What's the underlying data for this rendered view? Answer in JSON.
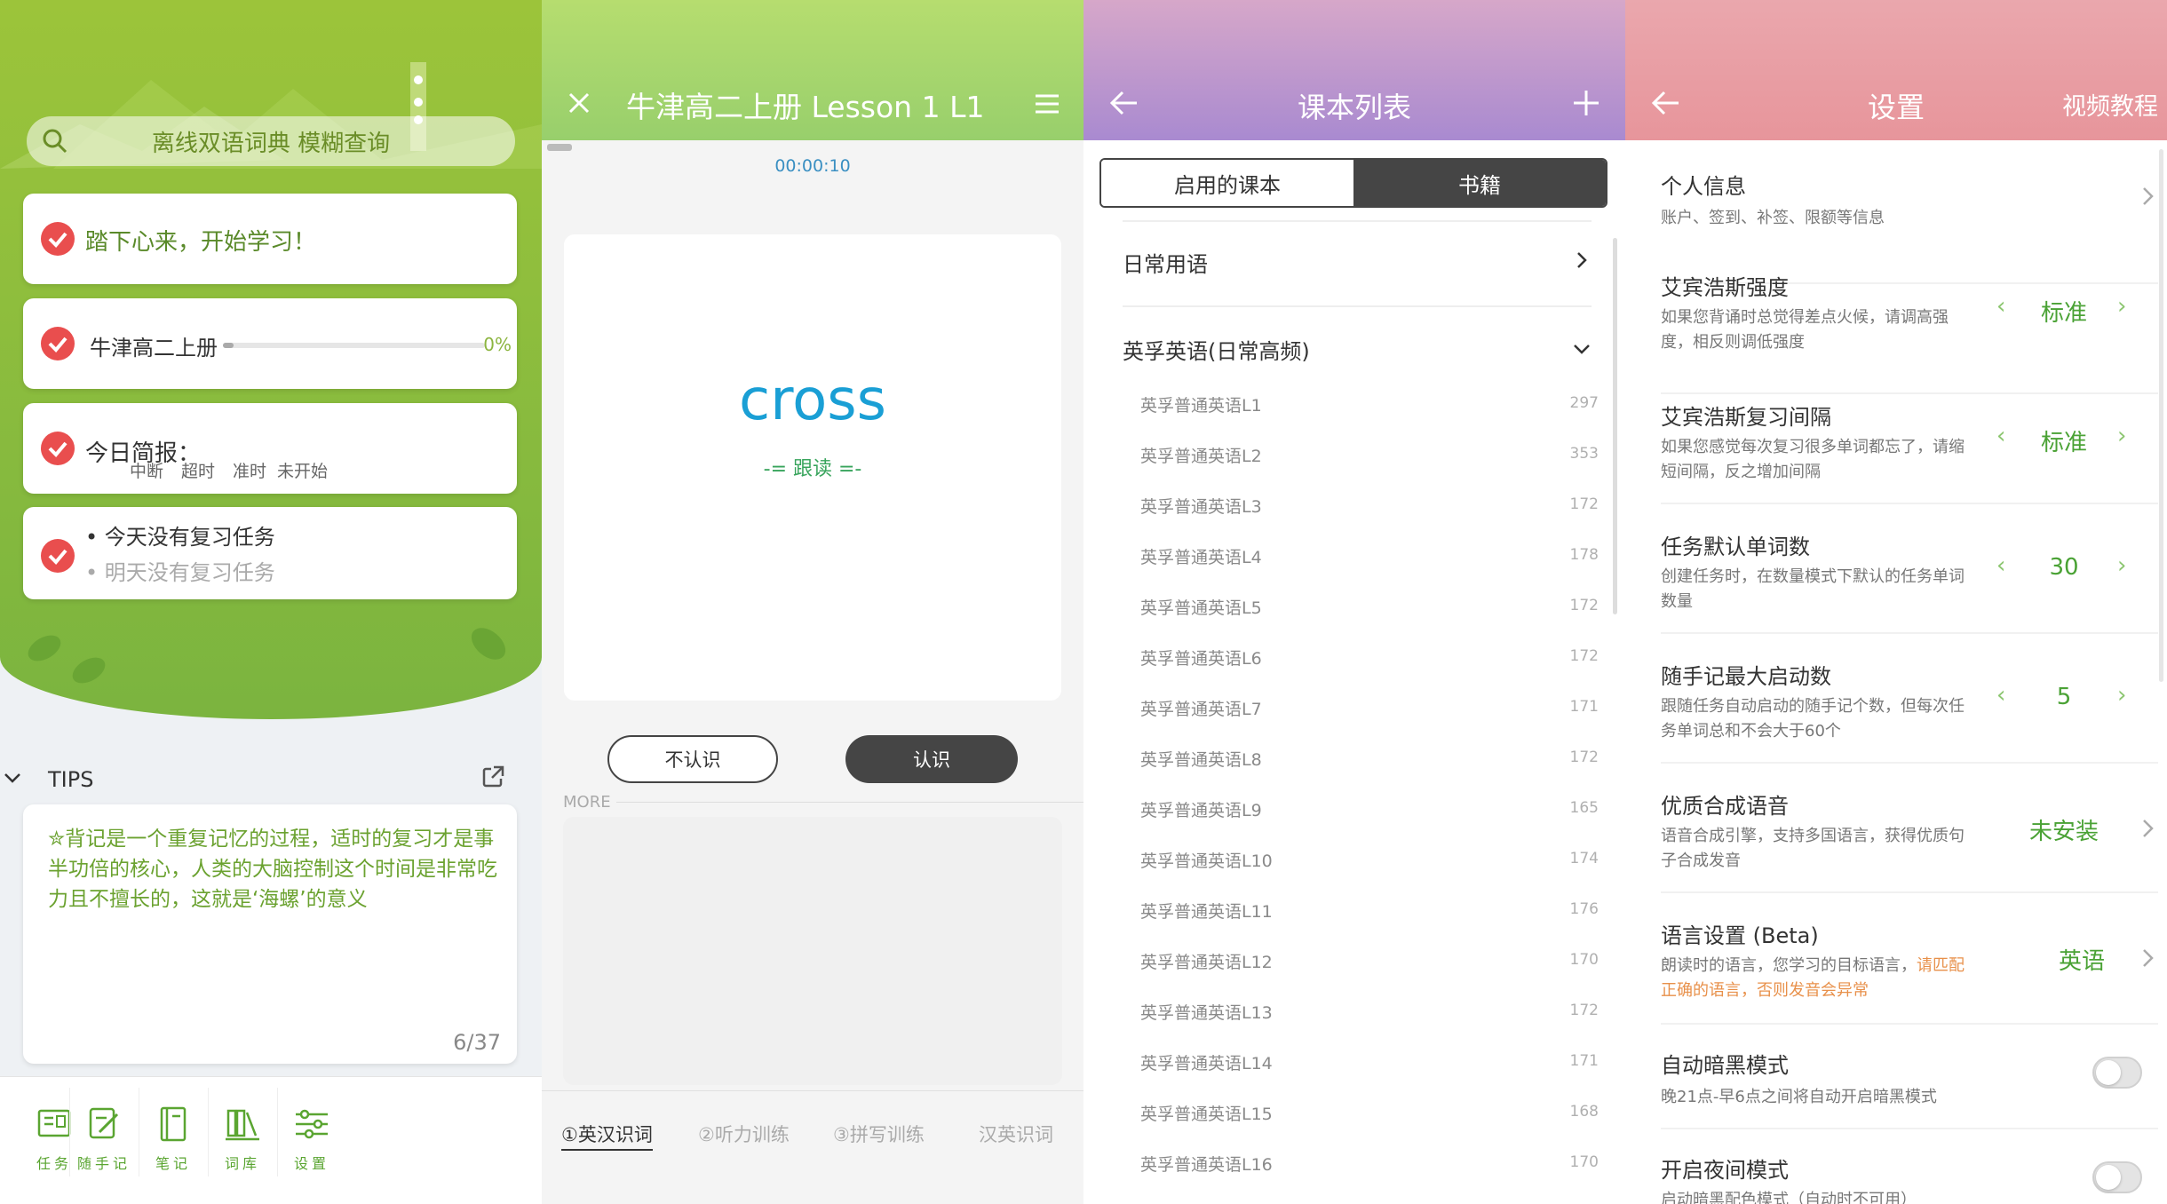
{
  "panel1": {
    "search_placeholder": "离线双语词典 模糊查询",
    "card_motivation": "踏下心来，开始学习！",
    "card_book_title": "牛津高二上册",
    "card_book_progress_label": "0%",
    "card_book_progress": 0.04,
    "card_brief_title": "今日简报：",
    "brief_labels": [
      "中断",
      "超时",
      "准时",
      "未开始"
    ],
    "review_today": "今天没有复习任务",
    "review_tomorrow": "明天没有复习任务",
    "tips_title": "TIPS",
    "tips_body": "✮背记是一个重复记忆的过程，适时的复习才是事半功倍的核心，人类的大脑控制这个时间是非常吃力且不擅长的，这就是‘海螺’的意义",
    "tips_page": "6/37",
    "tabs": [
      {
        "label": "任务",
        "icon": "task-icon"
      },
      {
        "label": "随手记",
        "icon": "note-pencil-icon"
      },
      {
        "label": "笔记",
        "icon": "notebook-icon"
      },
      {
        "label": "词库",
        "icon": "library-icon"
      },
      {
        "label": "设置",
        "icon": "settings-sliders-icon"
      }
    ],
    "accent": "#8fbe3d"
  },
  "panel2": {
    "title": "牛津高二上册 Lesson 1 L1",
    "timer": "00:00:10",
    "word": "cross",
    "follow": "-= 跟读 =-",
    "btn_unknown": "不认识",
    "btn_known": "认识",
    "more_label": "MORE",
    "tabs": [
      "①英汉识词",
      "②听力训练",
      "③拼写训练",
      "汉英识词"
    ],
    "accent": "#1a9fd5"
  },
  "panel3": {
    "title": "课本列表",
    "seg_enabled": "启用的课本",
    "seg_books": "书籍",
    "section1": "日常用语",
    "section2": "英孚英语(日常高频)",
    "lessons": [
      {
        "name": "英孚普通英语L1",
        "count": "297"
      },
      {
        "name": "英孚普通英语L2",
        "count": "353"
      },
      {
        "name": "英孚普通英语L3",
        "count": "172"
      },
      {
        "name": "英孚普通英语L4",
        "count": "178"
      },
      {
        "name": "英孚普通英语L5",
        "count": "172"
      },
      {
        "name": "英孚普通英语L6",
        "count": "172"
      },
      {
        "name": "英孚普通英语L7",
        "count": "171"
      },
      {
        "name": "英孚普通英语L8",
        "count": "172"
      },
      {
        "name": "英孚普通英语L9",
        "count": "165"
      },
      {
        "name": "英孚普通英语L10",
        "count": "174"
      },
      {
        "name": "英孚普通英语L11",
        "count": "176"
      },
      {
        "name": "英孚普通英语L12",
        "count": "170"
      },
      {
        "name": "英孚普通英语L13",
        "count": "172"
      },
      {
        "name": "英孚普通英语L14",
        "count": "171"
      },
      {
        "name": "英孚普通英语L15",
        "count": "168"
      },
      {
        "name": "英孚普通英语L16",
        "count": "170"
      }
    ]
  },
  "panel4": {
    "title": "设置",
    "video": "视频教程",
    "personal_title": "个人信息",
    "personal_desc": "账户、签到、补签、限额等信息",
    "strength_title": "艾宾浩斯强度",
    "strength_desc": "如果您背诵时总觉得差点火候，请调高强度，相反则调低强度",
    "strength_value": "标准",
    "interval_title": "艾宾浩斯复习间隔",
    "interval_desc": "如果您感觉每次复习很多单词都忘了，请缩短间隔，反之增加间隔",
    "interval_value": "标准",
    "words_title": "任务默认单词数",
    "words_desc": "创建任务时，在数量模式下默认的任务单词数量",
    "words_value": "30",
    "notes_title": "随手记最大启动数",
    "notes_desc": "跟随任务自动启动的随手记个数，但每次任务单词总和不会大于60个",
    "notes_value": "5",
    "tts_title": "优质合成语音",
    "tts_desc": "语音合成引擎，支持多国语言，获得优质句子合成发音",
    "tts_value": "未安装",
    "lang_title": "语言设置 (Beta)",
    "lang_desc_plain": "朗读时的语言，您学习的目标语言，",
    "lang_desc_warn": "请匹配正确的语言，否则发音会异常",
    "lang_value": "英语",
    "dark_title": "自动暗黑模式",
    "dark_desc": "晚21点-早6点之间将自动开启暗黑模式",
    "night_title": "开启夜间模式",
    "night_desc": "启动暗黑配色模式（自动时不可用）",
    "dark_on": false,
    "night_on": false
  }
}
